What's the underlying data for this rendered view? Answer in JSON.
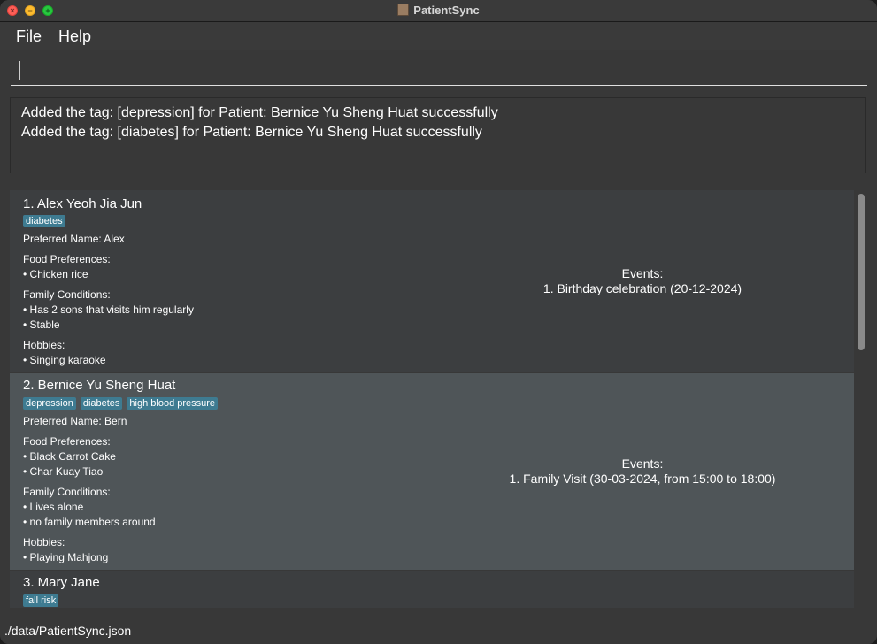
{
  "window": {
    "title": "PatientSync"
  },
  "menu": {
    "file": "File",
    "help": "Help"
  },
  "command": {
    "value": "",
    "placeholder": ""
  },
  "result": {
    "lines": [
      "Added the tag: [depression] for Patient: Bernice Yu Sheng Huat successfully",
      "Added the tag: [diabetes] for Patient: Bernice Yu Sheng Huat successfully"
    ]
  },
  "patients": [
    {
      "name": "1.  Alex Yeoh Jia Jun",
      "tags": [
        "diabetes"
      ],
      "preferred": "Preferred Name:  Alex",
      "food_label": "Food Preferences:",
      "food": [
        "• Chicken rice"
      ],
      "family_label": "Family Conditions:",
      "family": [
        "• Has 2 sons that visits him regularly",
        "• Stable"
      ],
      "hobbies_label": "Hobbies:",
      "hobbies": [
        "• Singing karaoke"
      ],
      "events_label": "Events:",
      "events": [
        "1. Birthday celebration (20-12-2024)"
      ]
    },
    {
      "name": "2.  Bernice Yu Sheng Huat",
      "tags": [
        "depression",
        "diabetes",
        "high blood pressure"
      ],
      "preferred": "Preferred Name:  Bern",
      "food_label": "Food Preferences:",
      "food": [
        "• Black Carrot Cake",
        "• Char Kuay Tiao"
      ],
      "family_label": "Family Conditions:",
      "family": [
        "• Lives alone",
        "• no family members around"
      ],
      "hobbies_label": "Hobbies:",
      "hobbies": [
        "• Playing Mahjong"
      ],
      "events_label": "Events:",
      "events": [
        "1. Family Visit (30-03-2024, from 15:00 to 18:00)"
      ]
    },
    {
      "name": "3.  Mary Jane",
      "tags": [
        "fall risk"
      ]
    }
  ],
  "status": {
    "file_path": "./data/PatientSync.json"
  },
  "colors": {
    "background": "#383838",
    "selected_card": "#4f5558",
    "card": "#3c3e40",
    "tag": "#3e7b91"
  }
}
